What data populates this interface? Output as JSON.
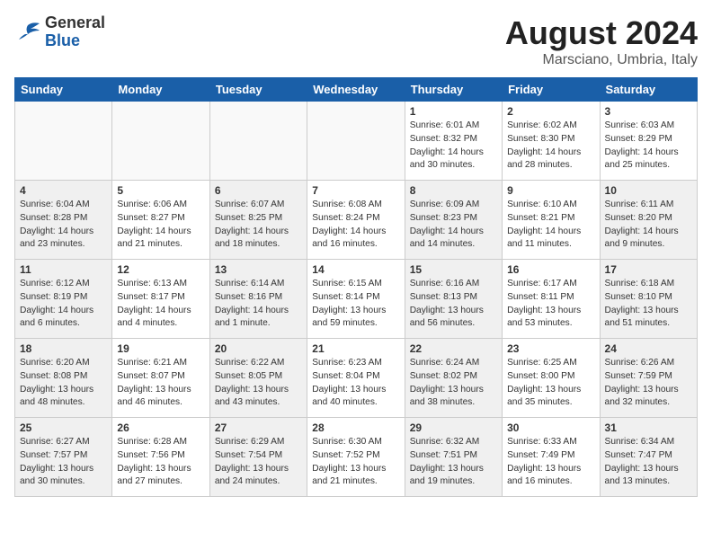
{
  "header": {
    "logo_general": "General",
    "logo_blue": "Blue",
    "month_title": "August 2024",
    "subtitle": "Marsciano, Umbria, Italy"
  },
  "weekdays": [
    "Sunday",
    "Monday",
    "Tuesday",
    "Wednesday",
    "Thursday",
    "Friday",
    "Saturday"
  ],
  "weeks": [
    [
      {
        "day": "",
        "info": "",
        "empty": true
      },
      {
        "day": "",
        "info": "",
        "empty": true
      },
      {
        "day": "",
        "info": "",
        "empty": true
      },
      {
        "day": "",
        "info": "",
        "empty": true
      },
      {
        "day": "1",
        "info": "Sunrise: 6:01 AM\nSunset: 8:32 PM\nDaylight: 14 hours\nand 30 minutes."
      },
      {
        "day": "2",
        "info": "Sunrise: 6:02 AM\nSunset: 8:30 PM\nDaylight: 14 hours\nand 28 minutes."
      },
      {
        "day": "3",
        "info": "Sunrise: 6:03 AM\nSunset: 8:29 PM\nDaylight: 14 hours\nand 25 minutes."
      }
    ],
    [
      {
        "day": "4",
        "info": "Sunrise: 6:04 AM\nSunset: 8:28 PM\nDaylight: 14 hours\nand 23 minutes.",
        "shaded": true
      },
      {
        "day": "5",
        "info": "Sunrise: 6:06 AM\nSunset: 8:27 PM\nDaylight: 14 hours\nand 21 minutes."
      },
      {
        "day": "6",
        "info": "Sunrise: 6:07 AM\nSunset: 8:25 PM\nDaylight: 14 hours\nand 18 minutes.",
        "shaded": true
      },
      {
        "day": "7",
        "info": "Sunrise: 6:08 AM\nSunset: 8:24 PM\nDaylight: 14 hours\nand 16 minutes."
      },
      {
        "day": "8",
        "info": "Sunrise: 6:09 AM\nSunset: 8:23 PM\nDaylight: 14 hours\nand 14 minutes.",
        "shaded": true
      },
      {
        "day": "9",
        "info": "Sunrise: 6:10 AM\nSunset: 8:21 PM\nDaylight: 14 hours\nand 11 minutes."
      },
      {
        "day": "10",
        "info": "Sunrise: 6:11 AM\nSunset: 8:20 PM\nDaylight: 14 hours\nand 9 minutes.",
        "shaded": true
      }
    ],
    [
      {
        "day": "11",
        "info": "Sunrise: 6:12 AM\nSunset: 8:19 PM\nDaylight: 14 hours\nand 6 minutes.",
        "shaded": true
      },
      {
        "day": "12",
        "info": "Sunrise: 6:13 AM\nSunset: 8:17 PM\nDaylight: 14 hours\nand 4 minutes."
      },
      {
        "day": "13",
        "info": "Sunrise: 6:14 AM\nSunset: 8:16 PM\nDaylight: 14 hours\nand 1 minute.",
        "shaded": true
      },
      {
        "day": "14",
        "info": "Sunrise: 6:15 AM\nSunset: 8:14 PM\nDaylight: 13 hours\nand 59 minutes."
      },
      {
        "day": "15",
        "info": "Sunrise: 6:16 AM\nSunset: 8:13 PM\nDaylight: 13 hours\nand 56 minutes.",
        "shaded": true
      },
      {
        "day": "16",
        "info": "Sunrise: 6:17 AM\nSunset: 8:11 PM\nDaylight: 13 hours\nand 53 minutes."
      },
      {
        "day": "17",
        "info": "Sunrise: 6:18 AM\nSunset: 8:10 PM\nDaylight: 13 hours\nand 51 minutes.",
        "shaded": true
      }
    ],
    [
      {
        "day": "18",
        "info": "Sunrise: 6:20 AM\nSunset: 8:08 PM\nDaylight: 13 hours\nand 48 minutes.",
        "shaded": true
      },
      {
        "day": "19",
        "info": "Sunrise: 6:21 AM\nSunset: 8:07 PM\nDaylight: 13 hours\nand 46 minutes."
      },
      {
        "day": "20",
        "info": "Sunrise: 6:22 AM\nSunset: 8:05 PM\nDaylight: 13 hours\nand 43 minutes.",
        "shaded": true
      },
      {
        "day": "21",
        "info": "Sunrise: 6:23 AM\nSunset: 8:04 PM\nDaylight: 13 hours\nand 40 minutes."
      },
      {
        "day": "22",
        "info": "Sunrise: 6:24 AM\nSunset: 8:02 PM\nDaylight: 13 hours\nand 38 minutes.",
        "shaded": true
      },
      {
        "day": "23",
        "info": "Sunrise: 6:25 AM\nSunset: 8:00 PM\nDaylight: 13 hours\nand 35 minutes."
      },
      {
        "day": "24",
        "info": "Sunrise: 6:26 AM\nSunset: 7:59 PM\nDaylight: 13 hours\nand 32 minutes.",
        "shaded": true
      }
    ],
    [
      {
        "day": "25",
        "info": "Sunrise: 6:27 AM\nSunset: 7:57 PM\nDaylight: 13 hours\nand 30 minutes.",
        "shaded": true
      },
      {
        "day": "26",
        "info": "Sunrise: 6:28 AM\nSunset: 7:56 PM\nDaylight: 13 hours\nand 27 minutes."
      },
      {
        "day": "27",
        "info": "Sunrise: 6:29 AM\nSunset: 7:54 PM\nDaylight: 13 hours\nand 24 minutes.",
        "shaded": true
      },
      {
        "day": "28",
        "info": "Sunrise: 6:30 AM\nSunset: 7:52 PM\nDaylight: 13 hours\nand 21 minutes."
      },
      {
        "day": "29",
        "info": "Sunrise: 6:32 AM\nSunset: 7:51 PM\nDaylight: 13 hours\nand 19 minutes.",
        "shaded": true
      },
      {
        "day": "30",
        "info": "Sunrise: 6:33 AM\nSunset: 7:49 PM\nDaylight: 13 hours\nand 16 minutes."
      },
      {
        "day": "31",
        "info": "Sunrise: 6:34 AM\nSunset: 7:47 PM\nDaylight: 13 hours\nand 13 minutes.",
        "shaded": true
      }
    ]
  ]
}
